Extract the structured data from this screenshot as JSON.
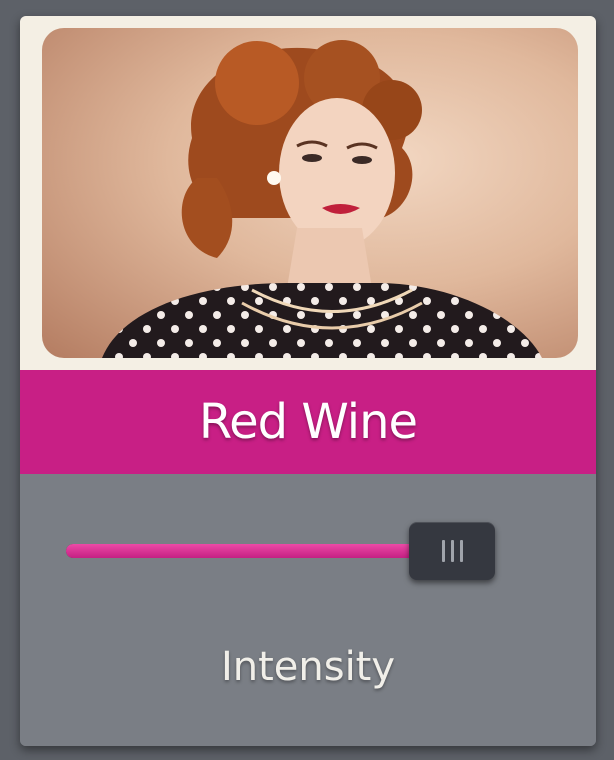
{
  "filter": {
    "name": "Red Wine",
    "accent_color": "#c81f85",
    "image_subject": "vintage portrait"
  },
  "intensity": {
    "label": "Intensity",
    "value": 0.92
  }
}
